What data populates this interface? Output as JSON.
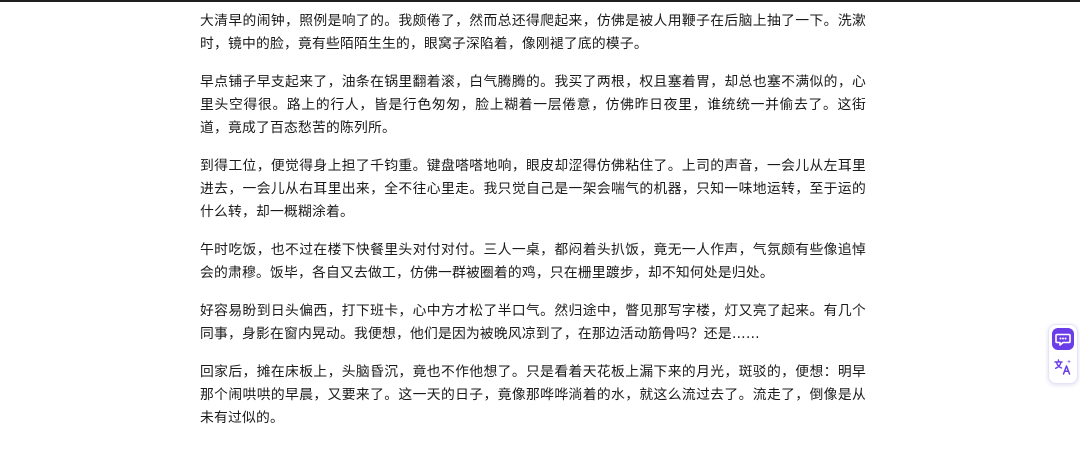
{
  "paragraphs": [
    "大清早的闹钟，照例是响了的。我颇倦了，然而总还得爬起来，仿佛是被人用鞭子在后脑上抽了一下。洗漱时，镜中的脸，竟有些陌陌生生的，眼窝子深陷着，像刚褪了底的模子。",
    "早点铺子早支起来了，油条在锅里翻着滚，白气腾腾的。我买了两根，权且塞着胃，却总也塞不满似的，心里头空得很。路上的行人，皆是行色匆匆，脸上糊着一层倦意，仿佛昨日夜里，谁统统一并偷去了。这街道，竟成了百态愁苦的陈列所。",
    "到得工位，便觉得身上担了千钧重。键盘嗒嗒地响，眼皮却涩得仿佛粘住了。上司的声音，一会儿从左耳里进去，一会儿从右耳里出来，全不往心里走。我只觉自己是一架会喘气的机器，只知一味地运转，至于运的什么转，却一概糊涂着。",
    "午时吃饭，也不过在楼下快餐里头对付对付。三人一桌，都闷着头扒饭，竟无一人作声，气氛颇有些像追悼会的肃穆。饭毕，各自又去做工，仿佛一群被圈着的鸡，只在栅里踱步，却不知何处是归处。",
    "好容易盼到日头偏西，打下班卡，心中方才松了半口气。然归途中，瞥见那写字楼，灯又亮了起来。有几个同事，身影在窗内晃动。我便想，他们是因为被晚风凉到了，在那边活动筋骨吗？还是……",
    "回家后，摊在床板上，头脑昏沉，竟也不作他想了。只是看着天花板上漏下来的月光，斑驳的，便想：明早那个闹哄哄的早晨，又要来了。这一天的日子，竟像那哗哗淌着的水，就这么流过去了。流走了，倒像是从未有过似的。"
  ],
  "tools": {
    "chat_icon": "chat-bubble-icon",
    "translate_icon": "translate-icon",
    "accent": "#6a3de8"
  }
}
